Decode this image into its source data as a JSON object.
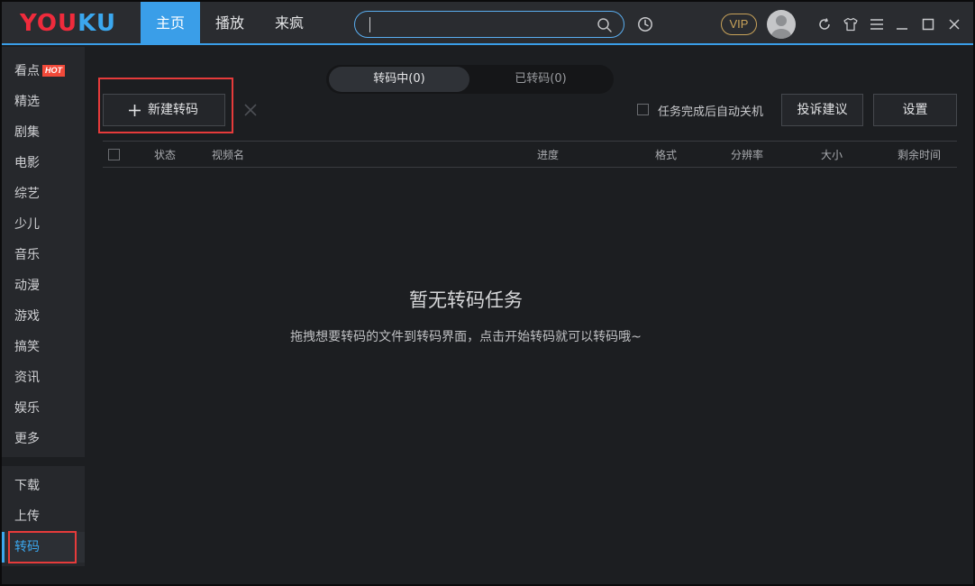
{
  "app": {
    "logo": {
      "part1": "Y",
      "part2": "OU",
      "part3": "K",
      "part4": "U"
    },
    "nav_tabs": [
      {
        "label": "主页",
        "active": true
      },
      {
        "label": "播放",
        "active": false
      },
      {
        "label": "来疯",
        "active": false
      }
    ],
    "search": {
      "value": "",
      "placeholder": ""
    },
    "vip_label": "VIP",
    "accent_color": "#3a9ee8",
    "highlight_color": "#e63b3b"
  },
  "sidebar": {
    "items": [
      {
        "label": "看点",
        "badge": "HOT"
      },
      {
        "label": "精选"
      },
      {
        "label": "剧集"
      },
      {
        "label": "电影"
      },
      {
        "label": "综艺"
      },
      {
        "label": "少儿"
      },
      {
        "label": "音乐"
      },
      {
        "label": "动漫"
      },
      {
        "label": "游戏"
      },
      {
        "label": "搞笑"
      },
      {
        "label": "资讯"
      },
      {
        "label": "娱乐"
      },
      {
        "label": "更多"
      }
    ],
    "tools": [
      {
        "label": "下载"
      },
      {
        "label": "上传"
      },
      {
        "label": "转码",
        "active": true
      }
    ]
  },
  "transcode": {
    "tabs": [
      {
        "label": "转码中(0)",
        "active": true
      },
      {
        "label": "已转码(0)",
        "active": false
      }
    ],
    "new_button": "新建转码",
    "auto_shutdown_label": "任务完成后自动关机",
    "auto_shutdown_checked": false,
    "complain_button": "投诉建议",
    "settings_button": "设置",
    "columns": [
      "状态",
      "视频名",
      "进度",
      "格式",
      "分辨率",
      "大小",
      "剩余时间"
    ],
    "empty_title": "暂无转码任务",
    "empty_desc": "拖拽想要转码的文件到转码界面，点击开始转码就可以转码哦~"
  }
}
